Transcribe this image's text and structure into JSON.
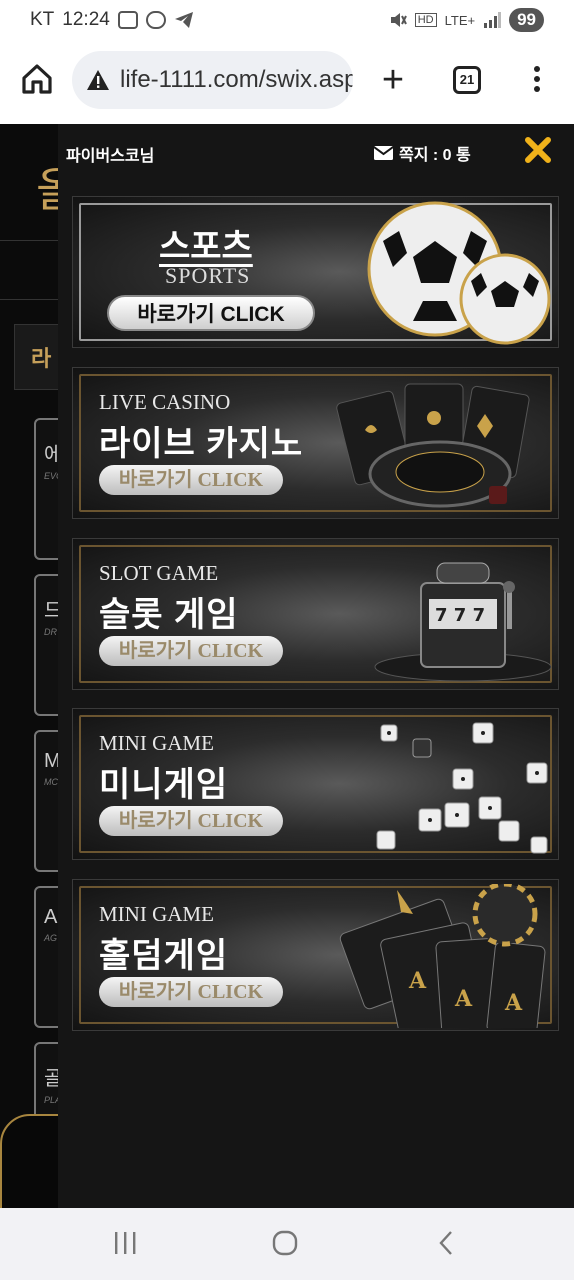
{
  "status": {
    "carrier": "KT",
    "time": "12:24",
    "network": "LTE+",
    "battery": "99"
  },
  "browser": {
    "url": "life-1111.com/swix.asp",
    "tab_count": "21"
  },
  "panel": {
    "username": "파이버스코님",
    "message_label": "쪽지 : 0 통"
  },
  "background": {
    "logo_char": "올",
    "tab_label": "라",
    "cards": [
      {
        "t": "에",
        "s": "EVC"
      },
      {
        "t": "드",
        "s": "DR"
      },
      {
        "t": "M",
        "s": "MC"
      },
      {
        "t": "A",
        "s": "AG"
      },
      {
        "t": "골",
        "s": "PLA"
      }
    ]
  },
  "banners": [
    {
      "id": "sports",
      "title": "스포츠",
      "subtitle": "SPORTS",
      "button": "바로가기 CLICK"
    },
    {
      "id": "casino",
      "subtitle": "LIVE CASINO",
      "title": "라이브 카지노",
      "button": "바로가기 CLICK"
    },
    {
      "id": "slot",
      "subtitle": "SLOT GAME",
      "title": "슬롯 게임",
      "button": "바로가기 CLICK"
    },
    {
      "id": "mini",
      "subtitle": "MINI GAME",
      "title": "미니게임",
      "button": "바로가기 CLICK"
    },
    {
      "id": "holdem",
      "subtitle": "MINI GAME",
      "title": "홀덤게임",
      "button": "바로가기 CLICK"
    }
  ],
  "colors": {
    "gold": "#f0b21a",
    "accent": "#c6a05a",
    "panel_bg": "#151515"
  }
}
